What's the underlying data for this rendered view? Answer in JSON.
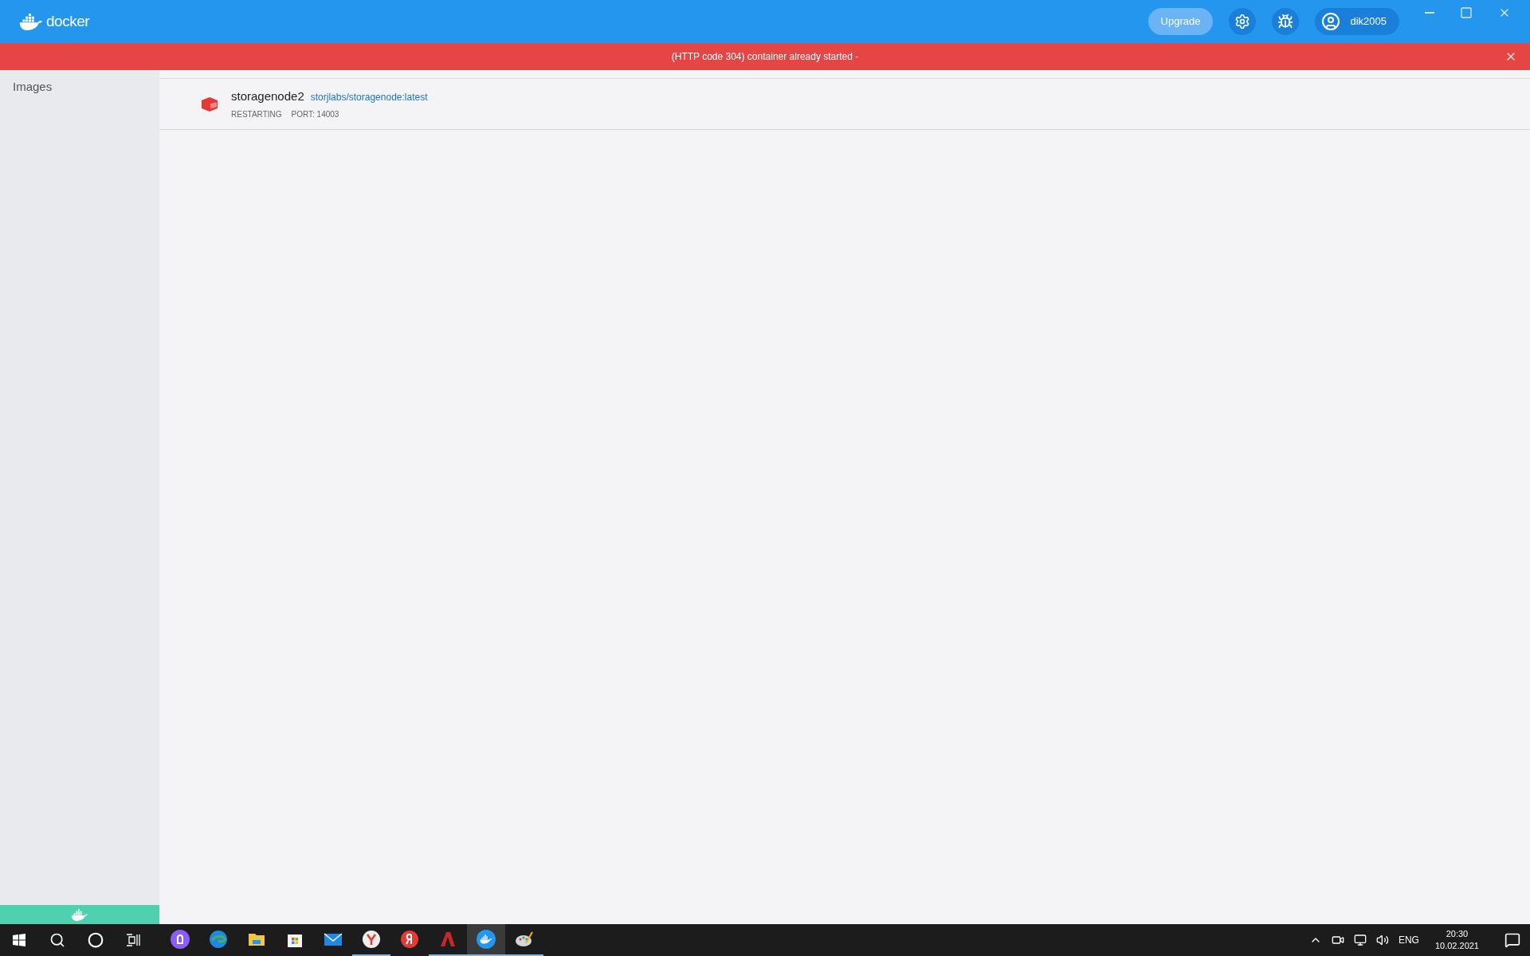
{
  "app_bar": {
    "logo_text": "docker",
    "upgrade_label": "Upgrade",
    "user": "dik2005"
  },
  "error_banner": {
    "message": "(HTTP code 304) container already started -"
  },
  "sidebar": {
    "items": [
      {
        "label": "Images",
        "selected": false
      }
    ]
  },
  "containers": [
    {
      "name": "storagenode2",
      "image": "storjlabs/storagenode:latest",
      "status": "RESTARTING",
      "port": "PORT: 14003",
      "color": "#e53935"
    }
  ],
  "taskbar": {
    "apps": [
      {
        "kind": "alice",
        "running": false,
        "selected": false
      },
      {
        "kind": "edge",
        "running": false,
        "selected": false
      },
      {
        "kind": "explorer",
        "running": false,
        "selected": false
      },
      {
        "kind": "store",
        "running": false,
        "selected": false
      },
      {
        "kind": "mail",
        "running": false,
        "selected": false
      },
      {
        "kind": "yandex-browser",
        "running": true,
        "selected": false
      },
      {
        "kind": "yandex",
        "running": false,
        "selected": false
      },
      {
        "kind": "autocad",
        "running": true,
        "selected": false
      },
      {
        "kind": "docker",
        "running": true,
        "selected": true
      },
      {
        "kind": "paint",
        "running": true,
        "selected": false
      }
    ],
    "language": "ENG",
    "time": "20:30",
    "date": "10.02.2021"
  }
}
